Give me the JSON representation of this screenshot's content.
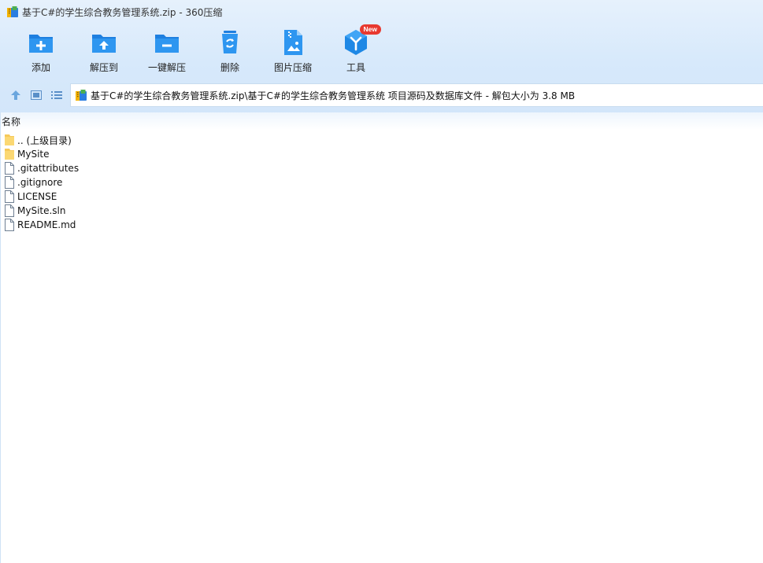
{
  "window": {
    "title": "基于C#的学生综合教务管理系统.zip - 360压缩",
    "app_icon": "archive-icon"
  },
  "toolbar": {
    "buttons": [
      {
        "label": "添加",
        "icon": "add-folder-icon"
      },
      {
        "label": "解压到",
        "icon": "extract-to-icon"
      },
      {
        "label": "一键解压",
        "icon": "one-click-extract-icon"
      },
      {
        "label": "删除",
        "icon": "recycle-bin-icon"
      },
      {
        "label": "图片压缩",
        "icon": "image-compress-icon"
      },
      {
        "label": "工具",
        "icon": "tools-icon",
        "badge": "New"
      }
    ]
  },
  "nav": {
    "up_icon": "up-arrow-icon",
    "view_icon": "thumbnail-view-icon",
    "list_icon": "list-view-icon",
    "address": "基于C#的学生综合教务管理系统.zip\\基于C#的学生综合教务管理系统 项目源码及数据库文件 - 解包大小为 3.8 MB"
  },
  "list": {
    "column_name": "名称",
    "items": [
      {
        "name": ".. (上级目录)",
        "type": "folder"
      },
      {
        "name": "MySite",
        "type": "folder"
      },
      {
        "name": ".gitattributes",
        "type": "file"
      },
      {
        "name": ".gitignore",
        "type": "file"
      },
      {
        "name": "LICENSE",
        "type": "file"
      },
      {
        "name": "MySite.sln",
        "type": "file"
      },
      {
        "name": "README.md",
        "type": "file"
      }
    ]
  },
  "colors": {
    "accent": "#1e88e5",
    "chrome_bg": "#d7e9fb",
    "badge": "#e8392f"
  }
}
